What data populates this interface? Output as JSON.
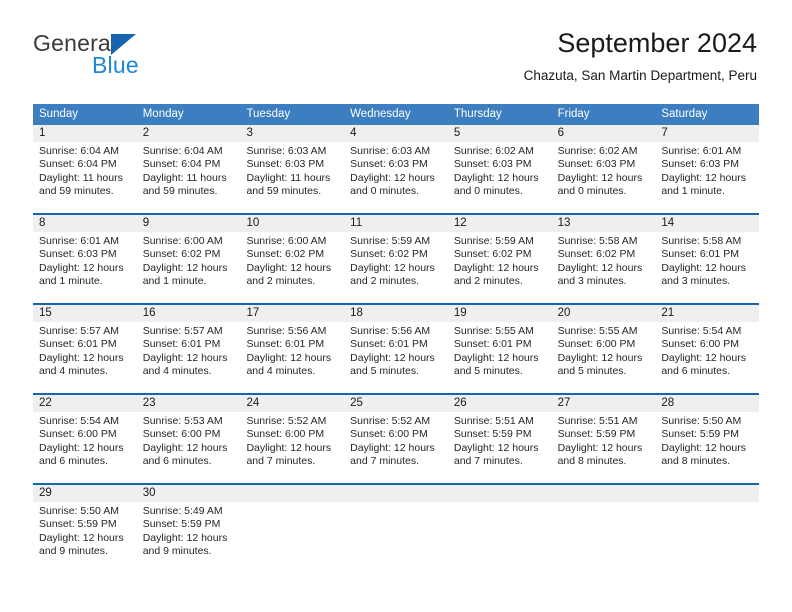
{
  "brand": {
    "name_part1": "General",
    "name_part2": "Blue",
    "logo_icon": "triangle-logo-icon"
  },
  "header": {
    "title": "September 2024",
    "subtitle": "Chazuta, San Martin Department, Peru"
  },
  "colors": {
    "header_blue": "#3c7ebf",
    "row_border_blue": "#1665b0",
    "date_band_gray": "#efefef",
    "brand_blue": "#1f86d8",
    "text": "#262626"
  },
  "weekdays": [
    "Sunday",
    "Monday",
    "Tuesday",
    "Wednesday",
    "Thursday",
    "Friday",
    "Saturday"
  ],
  "weeks": [
    [
      {
        "day": "1",
        "sunrise": "Sunrise: 6:04 AM",
        "sunset": "Sunset: 6:04 PM",
        "daylight1": "Daylight: 11 hours",
        "daylight2": "and 59 minutes."
      },
      {
        "day": "2",
        "sunrise": "Sunrise: 6:04 AM",
        "sunset": "Sunset: 6:04 PM",
        "daylight1": "Daylight: 11 hours",
        "daylight2": "and 59 minutes."
      },
      {
        "day": "3",
        "sunrise": "Sunrise: 6:03 AM",
        "sunset": "Sunset: 6:03 PM",
        "daylight1": "Daylight: 11 hours",
        "daylight2": "and 59 minutes."
      },
      {
        "day": "4",
        "sunrise": "Sunrise: 6:03 AM",
        "sunset": "Sunset: 6:03 PM",
        "daylight1": "Daylight: 12 hours",
        "daylight2": "and 0 minutes."
      },
      {
        "day": "5",
        "sunrise": "Sunrise: 6:02 AM",
        "sunset": "Sunset: 6:03 PM",
        "daylight1": "Daylight: 12 hours",
        "daylight2": "and 0 minutes."
      },
      {
        "day": "6",
        "sunrise": "Sunrise: 6:02 AM",
        "sunset": "Sunset: 6:03 PM",
        "daylight1": "Daylight: 12 hours",
        "daylight2": "and 0 minutes."
      },
      {
        "day": "7",
        "sunrise": "Sunrise: 6:01 AM",
        "sunset": "Sunset: 6:03 PM",
        "daylight1": "Daylight: 12 hours",
        "daylight2": "and 1 minute."
      }
    ],
    [
      {
        "day": "8",
        "sunrise": "Sunrise: 6:01 AM",
        "sunset": "Sunset: 6:03 PM",
        "daylight1": "Daylight: 12 hours",
        "daylight2": "and 1 minute."
      },
      {
        "day": "9",
        "sunrise": "Sunrise: 6:00 AM",
        "sunset": "Sunset: 6:02 PM",
        "daylight1": "Daylight: 12 hours",
        "daylight2": "and 1 minute."
      },
      {
        "day": "10",
        "sunrise": "Sunrise: 6:00 AM",
        "sunset": "Sunset: 6:02 PM",
        "daylight1": "Daylight: 12 hours",
        "daylight2": "and 2 minutes."
      },
      {
        "day": "11",
        "sunrise": "Sunrise: 5:59 AM",
        "sunset": "Sunset: 6:02 PM",
        "daylight1": "Daylight: 12 hours",
        "daylight2": "and 2 minutes."
      },
      {
        "day": "12",
        "sunrise": "Sunrise: 5:59 AM",
        "sunset": "Sunset: 6:02 PM",
        "daylight1": "Daylight: 12 hours",
        "daylight2": "and 2 minutes."
      },
      {
        "day": "13",
        "sunrise": "Sunrise: 5:58 AM",
        "sunset": "Sunset: 6:02 PM",
        "daylight1": "Daylight: 12 hours",
        "daylight2": "and 3 minutes."
      },
      {
        "day": "14",
        "sunrise": "Sunrise: 5:58 AM",
        "sunset": "Sunset: 6:01 PM",
        "daylight1": "Daylight: 12 hours",
        "daylight2": "and 3 minutes."
      }
    ],
    [
      {
        "day": "15",
        "sunrise": "Sunrise: 5:57 AM",
        "sunset": "Sunset: 6:01 PM",
        "daylight1": "Daylight: 12 hours",
        "daylight2": "and 4 minutes."
      },
      {
        "day": "16",
        "sunrise": "Sunrise: 5:57 AM",
        "sunset": "Sunset: 6:01 PM",
        "daylight1": "Daylight: 12 hours",
        "daylight2": "and 4 minutes."
      },
      {
        "day": "17",
        "sunrise": "Sunrise: 5:56 AM",
        "sunset": "Sunset: 6:01 PM",
        "daylight1": "Daylight: 12 hours",
        "daylight2": "and 4 minutes."
      },
      {
        "day": "18",
        "sunrise": "Sunrise: 5:56 AM",
        "sunset": "Sunset: 6:01 PM",
        "daylight1": "Daylight: 12 hours",
        "daylight2": "and 5 minutes."
      },
      {
        "day": "19",
        "sunrise": "Sunrise: 5:55 AM",
        "sunset": "Sunset: 6:01 PM",
        "daylight1": "Daylight: 12 hours",
        "daylight2": "and 5 minutes."
      },
      {
        "day": "20",
        "sunrise": "Sunrise: 5:55 AM",
        "sunset": "Sunset: 6:00 PM",
        "daylight1": "Daylight: 12 hours",
        "daylight2": "and 5 minutes."
      },
      {
        "day": "21",
        "sunrise": "Sunrise: 5:54 AM",
        "sunset": "Sunset: 6:00 PM",
        "daylight1": "Daylight: 12 hours",
        "daylight2": "and 6 minutes."
      }
    ],
    [
      {
        "day": "22",
        "sunrise": "Sunrise: 5:54 AM",
        "sunset": "Sunset: 6:00 PM",
        "daylight1": "Daylight: 12 hours",
        "daylight2": "and 6 minutes."
      },
      {
        "day": "23",
        "sunrise": "Sunrise: 5:53 AM",
        "sunset": "Sunset: 6:00 PM",
        "daylight1": "Daylight: 12 hours",
        "daylight2": "and 6 minutes."
      },
      {
        "day": "24",
        "sunrise": "Sunrise: 5:52 AM",
        "sunset": "Sunset: 6:00 PM",
        "daylight1": "Daylight: 12 hours",
        "daylight2": "and 7 minutes."
      },
      {
        "day": "25",
        "sunrise": "Sunrise: 5:52 AM",
        "sunset": "Sunset: 6:00 PM",
        "daylight1": "Daylight: 12 hours",
        "daylight2": "and 7 minutes."
      },
      {
        "day": "26",
        "sunrise": "Sunrise: 5:51 AM",
        "sunset": "Sunset: 5:59 PM",
        "daylight1": "Daylight: 12 hours",
        "daylight2": "and 7 minutes."
      },
      {
        "day": "27",
        "sunrise": "Sunrise: 5:51 AM",
        "sunset": "Sunset: 5:59 PM",
        "daylight1": "Daylight: 12 hours",
        "daylight2": "and 8 minutes."
      },
      {
        "day": "28",
        "sunrise": "Sunrise: 5:50 AM",
        "sunset": "Sunset: 5:59 PM",
        "daylight1": "Daylight: 12 hours",
        "daylight2": "and 8 minutes."
      }
    ],
    [
      {
        "day": "29",
        "sunrise": "Sunrise: 5:50 AM",
        "sunset": "Sunset: 5:59 PM",
        "daylight1": "Daylight: 12 hours",
        "daylight2": "and 9 minutes."
      },
      {
        "day": "30",
        "sunrise": "Sunrise: 5:49 AM",
        "sunset": "Sunset: 5:59 PM",
        "daylight1": "Daylight: 12 hours",
        "daylight2": "and 9 minutes."
      },
      {
        "day": "",
        "sunrise": "",
        "sunset": "",
        "daylight1": "",
        "daylight2": ""
      },
      {
        "day": "",
        "sunrise": "",
        "sunset": "",
        "daylight1": "",
        "daylight2": ""
      },
      {
        "day": "",
        "sunrise": "",
        "sunset": "",
        "daylight1": "",
        "daylight2": ""
      },
      {
        "day": "",
        "sunrise": "",
        "sunset": "",
        "daylight1": "",
        "daylight2": ""
      },
      {
        "day": "",
        "sunrise": "",
        "sunset": "",
        "daylight1": "",
        "daylight2": ""
      }
    ]
  ]
}
